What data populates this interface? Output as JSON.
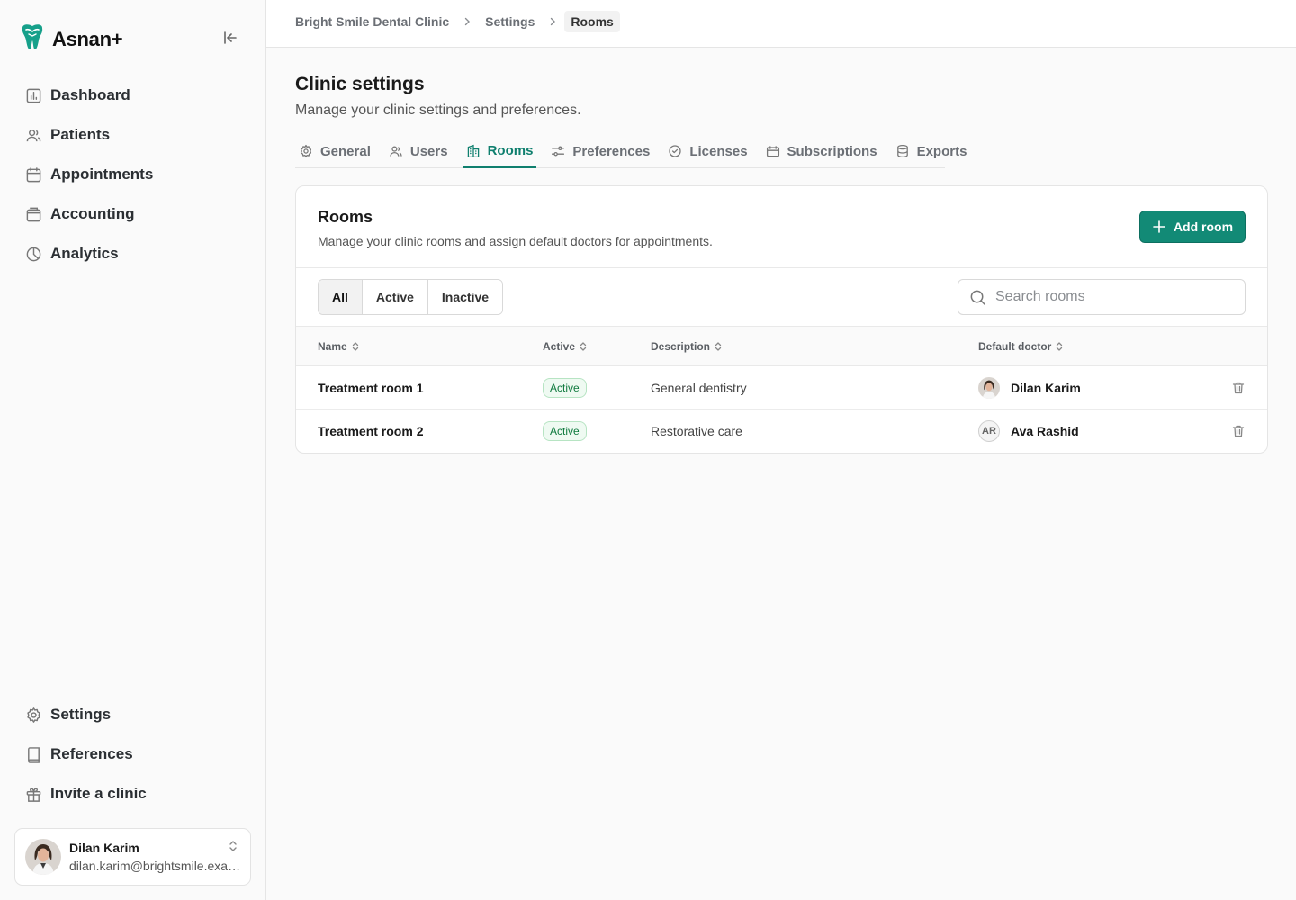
{
  "app": {
    "name": "Asnan+"
  },
  "sidebar": {
    "nav": [
      {
        "label": "Dashboard",
        "icon": "chart-bar-icon"
      },
      {
        "label": "Patients",
        "icon": "users-icon"
      },
      {
        "label": "Appointments",
        "icon": "calendar-icon"
      },
      {
        "label": "Accounting",
        "icon": "wallet-icon"
      },
      {
        "label": "Analytics",
        "icon": "pie-chart-icon"
      }
    ],
    "bottom": [
      {
        "label": "Settings",
        "icon": "gear-icon"
      },
      {
        "label": "References",
        "icon": "book-icon"
      },
      {
        "label": "Invite a clinic",
        "icon": "gift-icon"
      }
    ],
    "user": {
      "name": "Dilan Karim",
      "email": "dilan.karim@brightsmile.example.com"
    }
  },
  "breadcrumb": [
    "Bright Smile Dental Clinic",
    "Settings",
    "Rooms"
  ],
  "page": {
    "title": "Clinic settings",
    "subtitle": "Manage your clinic settings and preferences."
  },
  "tabs": [
    {
      "label": "General",
      "icon": "gear-icon"
    },
    {
      "label": "Users",
      "icon": "users-icon"
    },
    {
      "label": "Rooms",
      "icon": "building-icon",
      "active": true
    },
    {
      "label": "Preferences",
      "icon": "sliders-icon"
    },
    {
      "label": "Licenses",
      "icon": "check-circle-icon"
    },
    {
      "label": "Subscriptions",
      "icon": "ticket-icon"
    },
    {
      "label": "Exports",
      "icon": "database-icon"
    }
  ],
  "rooms_card": {
    "title": "Rooms",
    "subtitle": "Manage your clinic rooms and assign default doctors for appointments.",
    "add_label": "Add room",
    "filters": [
      "All",
      "Active",
      "Inactive"
    ],
    "selected_filter": "All",
    "search_placeholder": "Search rooms",
    "columns": [
      "Name",
      "Active",
      "Description",
      "Default doctor"
    ],
    "rows": [
      {
        "name": "Treatment room 1",
        "status": "Active",
        "description": "General dentistry",
        "doctor": "Dilan Karim",
        "doctor_avatar": "photo"
      },
      {
        "name": "Treatment room 2",
        "status": "Active",
        "description": "Restorative care",
        "doctor": "Ava Rashid",
        "doctor_initials": "AR"
      }
    ]
  },
  "colors": {
    "accent": "#128a76",
    "active_tab": "#0f7f6e",
    "badge_green": "#0f7a3e"
  }
}
